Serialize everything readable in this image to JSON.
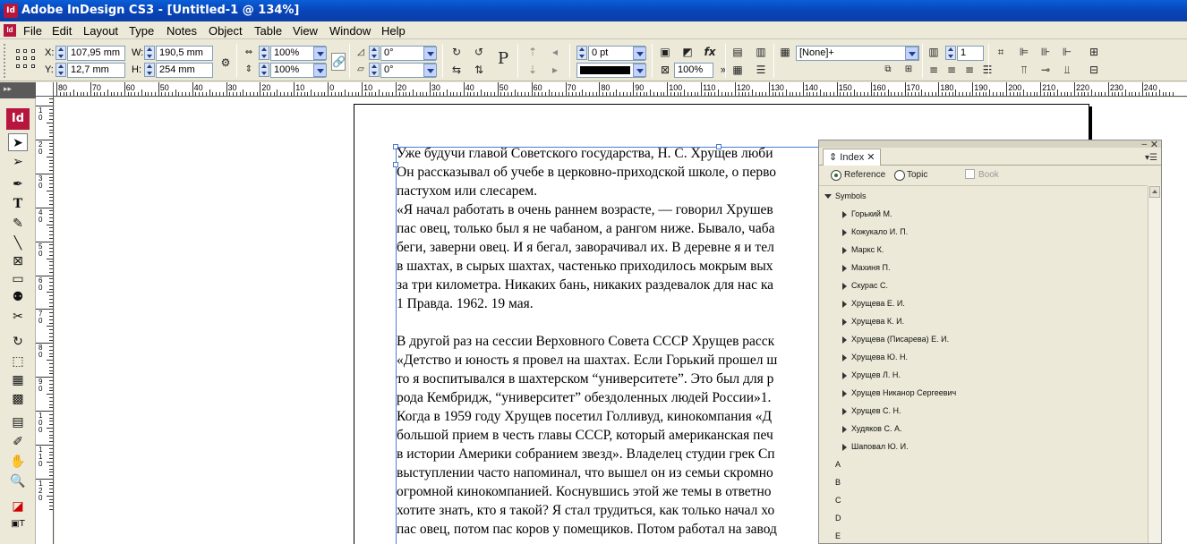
{
  "window": {
    "title": "Adobe InDesign CS3 - [Untitled-1 @ 134%]",
    "app_icon": "Id"
  },
  "menus": [
    "File",
    "Edit",
    "Layout",
    "Type",
    "Notes",
    "Object",
    "Table",
    "View",
    "Window",
    "Help"
  ],
  "control": {
    "x_label": "X:",
    "x_value": "107,95 mm",
    "y_label": "Y:",
    "y_value": "12,7 mm",
    "w_label": "W:",
    "w_value": "190,5 mm",
    "h_label": "H:",
    "h_value": "254 mm",
    "scale_x": "100%",
    "scale_y": "100%",
    "rotate": "0°",
    "shear": "0°",
    "stroke_weight": "0 pt",
    "opacity": "100%",
    "object_style": "[None]+",
    "columns": "1"
  },
  "ruler_h_labels": [
    "80",
    "70",
    "60",
    "50",
    "40",
    "30",
    "20",
    "10",
    "0",
    "10",
    "20",
    "30",
    "40",
    "50",
    "60",
    "70",
    "80",
    "90",
    "100",
    "110",
    "120",
    "130",
    "140",
    "150",
    "160",
    "170",
    "180",
    "190",
    "200",
    "210",
    "220",
    "230",
    "240"
  ],
  "ruler_v_labels": [
    "1\n0",
    "2\n0",
    "3\n0",
    "4\n0",
    "5\n0",
    "6\n0",
    "7\n0",
    "8\n0",
    "9\n0",
    "1\n0\n0",
    "1\n1\n0",
    "1\n2\n0"
  ],
  "document": {
    "lines": [
      "Уже будучи главой Советского государства, Н. С. Хрущев люби",
      "Он рассказывал об учебе в церковно-приходской школе, о перво",
      "пастухом или слесарем.",
      "«Я начал работать в очень раннем возрасте, — говорил Хрушев",
      "пас овец, только был я не чабаном, а рангом ниже. Бывало, чаба",
      "беги, заверни овец. И я бегал, заворачивал их. В деревне я и тел",
      "в шахтах, в сырых шахтах, частенько приходилось мокрым вых",
      "за три километра. Никаких бань, никаких раздевалок для нас ка",
      "1 Правда. 1962. 19 мая.",
      "",
      "В другой раз на сессии Верховного Совета СССР Хрущев расск",
      "«Детство и юность я провел на шахтах. Если Горький прошел ш",
      "то я воспитывался в шахтерском “университете”. Это был для р",
      "рода Кембридж, “университет” обездоленных людей России»1.",
      "Когда в 1959 году Хрущев посетил Голливуд, кинокомпания «Д",
      "большой прием в честь главы СССР, который американская печ",
      "в истории Америки собранием звезд». Владелец студии грек Сп",
      "выступлении часто напоминал, что вышел он из семьи скромно",
      "огромной кинокомпанией. Коснувшись этой же темы в ответно",
      "хотите знать, кто я такой? Я стал трудиться, как только начал хо",
      "пас овец, потом пас коров у помещиков. Потом работал на завод"
    ]
  },
  "index_panel": {
    "tab_label": "Index",
    "reference_label": "Reference",
    "topic_label": "Topic",
    "book_label": "Book",
    "mode": "Reference",
    "group_label": "Symbols",
    "entries": [
      "Горький М.",
      "Кожукало И. П.",
      "Маркс К.",
      "Махиня П.",
      "Скурас С.",
      "Хрущева Е. И.",
      "Хрущева К. И.",
      "Хрущева (Писарева) Е. И.",
      "Хрущева Ю. Н.",
      "Хрущев Л. Н.",
      "Хрущев Никанор Сергеевич",
      "Хрущев С. Н.",
      "Худяков С. А.",
      "Шаповал Ю. И."
    ],
    "letters": [
      "A",
      "B",
      "C",
      "D",
      "E"
    ]
  }
}
